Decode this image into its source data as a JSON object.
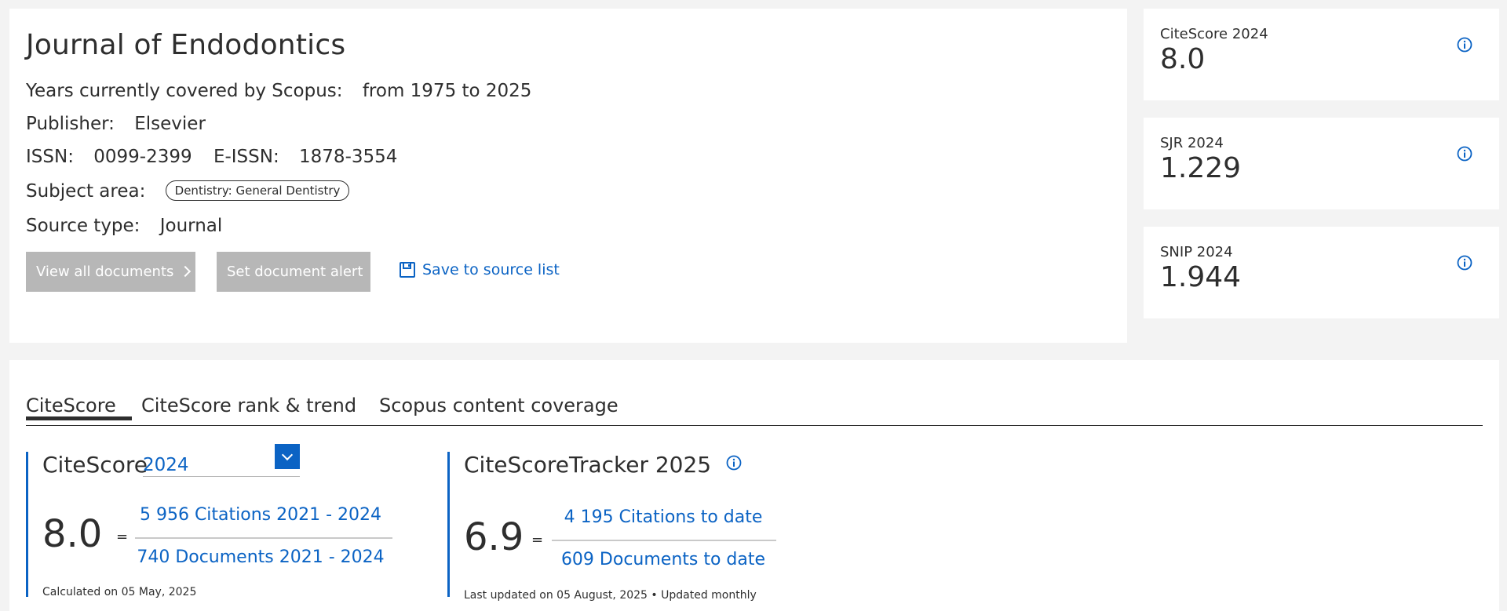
{
  "journal": {
    "title": "Journal of Endodontics",
    "years_label": "Years currently covered by Scopus:",
    "years_value": "from 1975 to 2025",
    "publisher_label": "Publisher:",
    "publisher_value": "Elsevier",
    "issn_label": "ISSN:",
    "issn_value": "0099-2399",
    "eissn_label": "E-ISSN:",
    "eissn_value": "1878-3554",
    "subject_label": "Subject area:",
    "subject_chip": "Dentistry: General Dentistry",
    "source_type_label": "Source type:",
    "source_type_value": "Journal"
  },
  "actions": {
    "view_all": "View all documents",
    "set_alert": "Set document alert",
    "save_to_list": "Save to source list"
  },
  "metrics": [
    {
      "label": "CiteScore 2024",
      "value": "8.0"
    },
    {
      "label": "SJR 2024",
      "value": "1.229"
    },
    {
      "label": "SNIP 2024",
      "value": "1.944"
    }
  ],
  "tabs": [
    {
      "label": "CiteScore",
      "active": true
    },
    {
      "label": "CiteScore rank & trend",
      "active": false
    },
    {
      "label": "Scopus content coverage",
      "active": false
    }
  ],
  "citescore": {
    "title": "CiteScore",
    "year": "2024",
    "score": "8.0",
    "eq": "=",
    "numerator": "5 956 Citations 2021 - 2024",
    "denominator": "740 Documents 2021 - 2024",
    "note": "Calculated on 05 May, 2025"
  },
  "tracker": {
    "title": "CiteScoreTracker 2025",
    "score": "6.9",
    "eq": "=",
    "numerator": "4 195 Citations to date",
    "denominator": "609 Documents to date",
    "note": "Last updated on 05 August, 2025 • Updated monthly"
  },
  "colors": {
    "accent": "#0b63c4",
    "button_disabled": "#b7b7b7",
    "background": "#f3f3f3"
  }
}
